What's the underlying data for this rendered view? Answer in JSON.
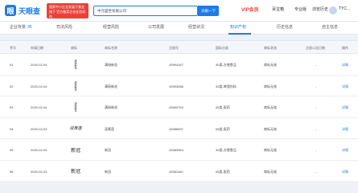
{
  "header": {
    "logo_text": "天眼查",
    "promo_text": "国家中小企业发展子基金旗下 官方备案企业征信机构",
    "search_value": "中元盛世有限公司",
    "search_button": "天眼一下",
    "nav_vip": "VIP会员",
    "nav_items": [
      "百宝箱",
      "专业版",
      "浏览历史",
      "TYC..."
    ]
  },
  "tabs": [
    {
      "label": "企业背景",
      "count": "35",
      "active": false
    },
    {
      "label": "司法风险",
      "count": "",
      "active": false
    },
    {
      "label": "经营风险",
      "count": "",
      "active": false
    },
    {
      "label": "公司发展",
      "count": "",
      "active": false
    },
    {
      "label": "经营状况",
      "count": "",
      "active": false
    },
    {
      "label": "知识产权",
      "count": "",
      "active": true
    },
    {
      "label": "历史信息",
      "count": "",
      "active": false
    },
    {
      "label": "自主信息",
      "count": "",
      "active": false
    }
  ],
  "table": {
    "columns": [
      "序号",
      "申请日期",
      "商标",
      "商标名称",
      "注册号",
      "国际分类",
      "商标状态",
      "注册公告日期",
      "操作"
    ],
    "rows": [
      {
        "no": "91",
        "date": "2020-02-04",
        "mark": "vertical",
        "name": "满瑶新花",
        "reg": "43994167",
        "cls": "30类-方便食品",
        "status": "商标无效",
        "pub": "-",
        "op": "详情"
      },
      {
        "no": "92",
        "date": "2020-02-04",
        "mark": "vertical",
        "name": "满瑶新花",
        "reg": "43993086",
        "cls": "33类-啤酒饮料",
        "status": "商标无效",
        "pub": "-",
        "op": "详情"
      },
      {
        "no": "93",
        "date": "2020-02-04",
        "mark": "vertical",
        "name": "满瑶新花",
        "reg": "43990753",
        "cls": "05类-医药",
        "status": "商标无效",
        "pub": "-",
        "op": "详情"
      },
      {
        "no": "94",
        "date": "2020-02-03",
        "mark": "calligraphy",
        "name": "双黄莲",
        "reg": "43988397",
        "cls": "05类-医药",
        "status": "商标无效",
        "pub": "-",
        "op": "详情"
      },
      {
        "no": "95",
        "date": "2020-02-03",
        "mark": "text",
        "name": "新冠",
        "reg": "43983364",
        "cls": "30类-方便食品",
        "status": "商标无效",
        "pub": "-",
        "op": "详情"
      },
      {
        "no": "96",
        "date": "2020-02-03",
        "mark": "text",
        "name": "新冠",
        "reg": "43981160",
        "cls": "05类-医药",
        "status": "商标无效",
        "pub": "-",
        "op": "详情"
      }
    ]
  },
  "mark_text": {
    "calligraphy": "双黄莲",
    "text": "新冠",
    "vertical": "满瑶新花"
  }
}
